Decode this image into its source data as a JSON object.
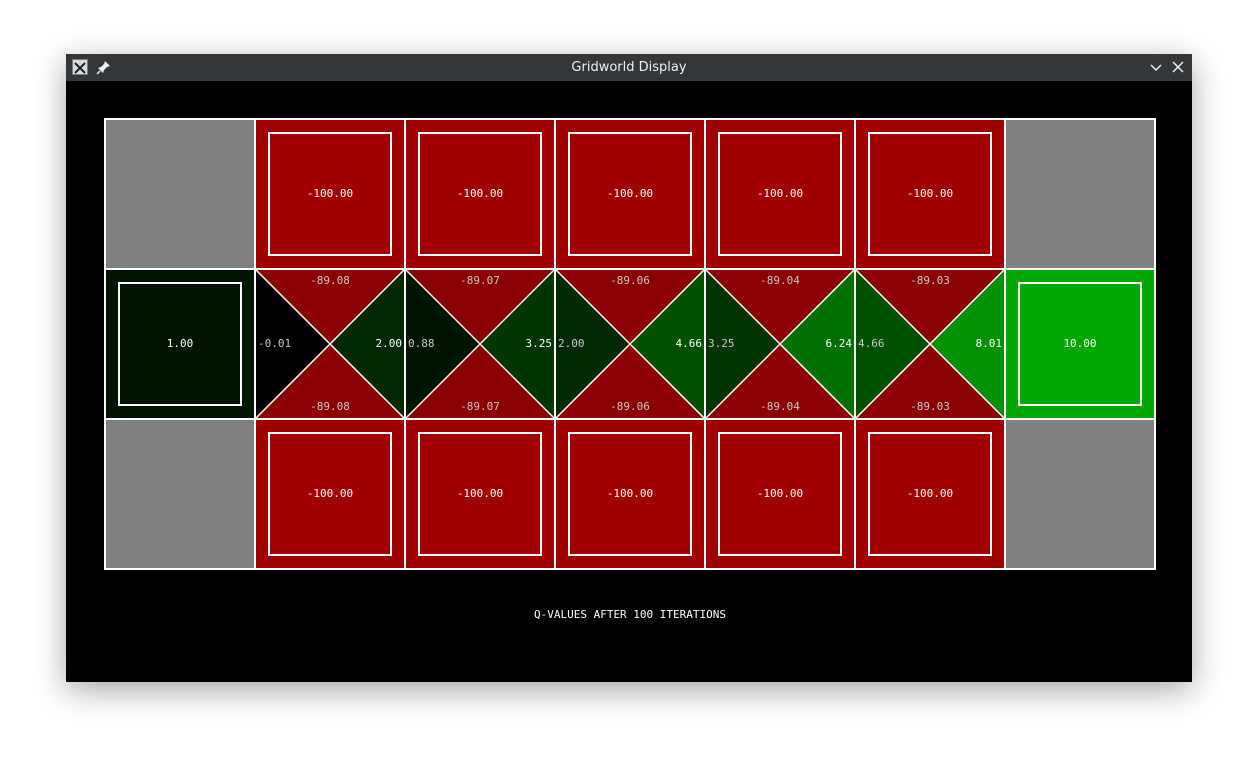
{
  "window": {
    "title": "Gridworld Display"
  },
  "status_text": "Q-VALUES AFTER 100 ITERATIONS",
  "colors": {
    "wall": "#808080",
    "pit": "#a00000",
    "grid_line": "#ffffff",
    "background": "#000000"
  },
  "grid": {
    "rows": [
      [
        {
          "kind": "wall"
        },
        {
          "kind": "terminal",
          "value": "-100.00",
          "color": "#a00000"
        },
        {
          "kind": "terminal",
          "value": "-100.00",
          "color": "#a00000"
        },
        {
          "kind": "terminal",
          "value": "-100.00",
          "color": "#a00000"
        },
        {
          "kind": "terminal",
          "value": "-100.00",
          "color": "#a00000"
        },
        {
          "kind": "terminal",
          "value": "-100.00",
          "color": "#a00000"
        },
        {
          "kind": "wall"
        }
      ],
      [
        {
          "kind": "terminal",
          "value": "1.00",
          "color": "#001400"
        },
        {
          "kind": "q",
          "north": "-89.08",
          "south": "-89.08",
          "west": "-0.01",
          "east": "2.00",
          "colors": {
            "north": "#8a0000",
            "south": "#8a0000",
            "west": "#000000",
            "east": "#002800"
          }
        },
        {
          "kind": "q",
          "north": "-89.07",
          "south": "-89.07",
          "west": "0.88",
          "east": "3.25",
          "colors": {
            "north": "#8a0000",
            "south": "#8a0000",
            "west": "#001400",
            "east": "#003500"
          }
        },
        {
          "kind": "q",
          "north": "-89.06",
          "south": "-89.06",
          "west": "2.00",
          "east": "4.66",
          "colors": {
            "north": "#8a0000",
            "south": "#8a0000",
            "west": "#002800",
            "east": "#005000"
          }
        },
        {
          "kind": "q",
          "north": "-89.04",
          "south": "-89.04",
          "west": "3.25",
          "east": "6.24",
          "colors": {
            "north": "#8a0000",
            "south": "#8a0000",
            "west": "#003500",
            "east": "#007000"
          }
        },
        {
          "kind": "q",
          "north": "-89.03",
          "south": "-89.03",
          "west": "4.66",
          "east": "8.01",
          "colors": {
            "north": "#8a0000",
            "south": "#8a0000",
            "west": "#005000",
            "east": "#009000"
          }
        },
        {
          "kind": "terminal",
          "value": "10.00",
          "color": "#00a800"
        }
      ],
      [
        {
          "kind": "wall"
        },
        {
          "kind": "terminal",
          "value": "-100.00",
          "color": "#a00000"
        },
        {
          "kind": "terminal",
          "value": "-100.00",
          "color": "#a00000"
        },
        {
          "kind": "terminal",
          "value": "-100.00",
          "color": "#a00000"
        },
        {
          "kind": "terminal",
          "value": "-100.00",
          "color": "#a00000"
        },
        {
          "kind": "terminal",
          "value": "-100.00",
          "color": "#a00000"
        },
        {
          "kind": "wall"
        }
      ]
    ]
  }
}
